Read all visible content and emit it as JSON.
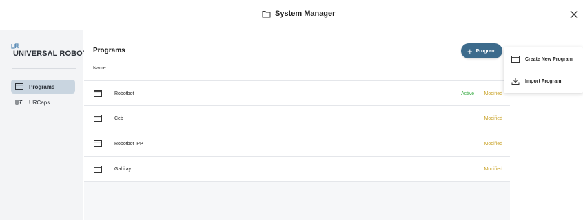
{
  "header": {
    "title": "System Manager",
    "folder_icon": "folder-icon",
    "close_icon": "close-icon"
  },
  "sidebar": {
    "brand": "UNIVERSAL ROBOTS",
    "logo_icon": "ur-logo-icon",
    "items": [
      {
        "label": "Programs",
        "icon": "program-window-icon",
        "active": true
      },
      {
        "label": "URCaps",
        "icon": "urcaps-icon",
        "active": false
      }
    ]
  },
  "main": {
    "title": "Programs",
    "column_header": "Name",
    "add_button": {
      "label": "Program",
      "icon": "plus-icon"
    },
    "rows": [
      {
        "name": "Robotbot",
        "active": "Active",
        "status": "Modified"
      },
      {
        "name": "Ceb",
        "active": "",
        "status": "Modified"
      },
      {
        "name": "Robotbot_PP",
        "active": "",
        "status": "Modified"
      },
      {
        "name": "Gabitay",
        "active": "",
        "status": "Modified"
      }
    ]
  },
  "dropdown": {
    "items": [
      {
        "label": "Create New Program",
        "icon": "new-program-icon"
      },
      {
        "label": "Import Program",
        "icon": "import-icon"
      }
    ]
  },
  "colors": {
    "accent": "#3d6b8c",
    "active_green": "#3fae49",
    "modified_gold": "#c9a227",
    "sidebar_selected": "#c9d5e0"
  }
}
